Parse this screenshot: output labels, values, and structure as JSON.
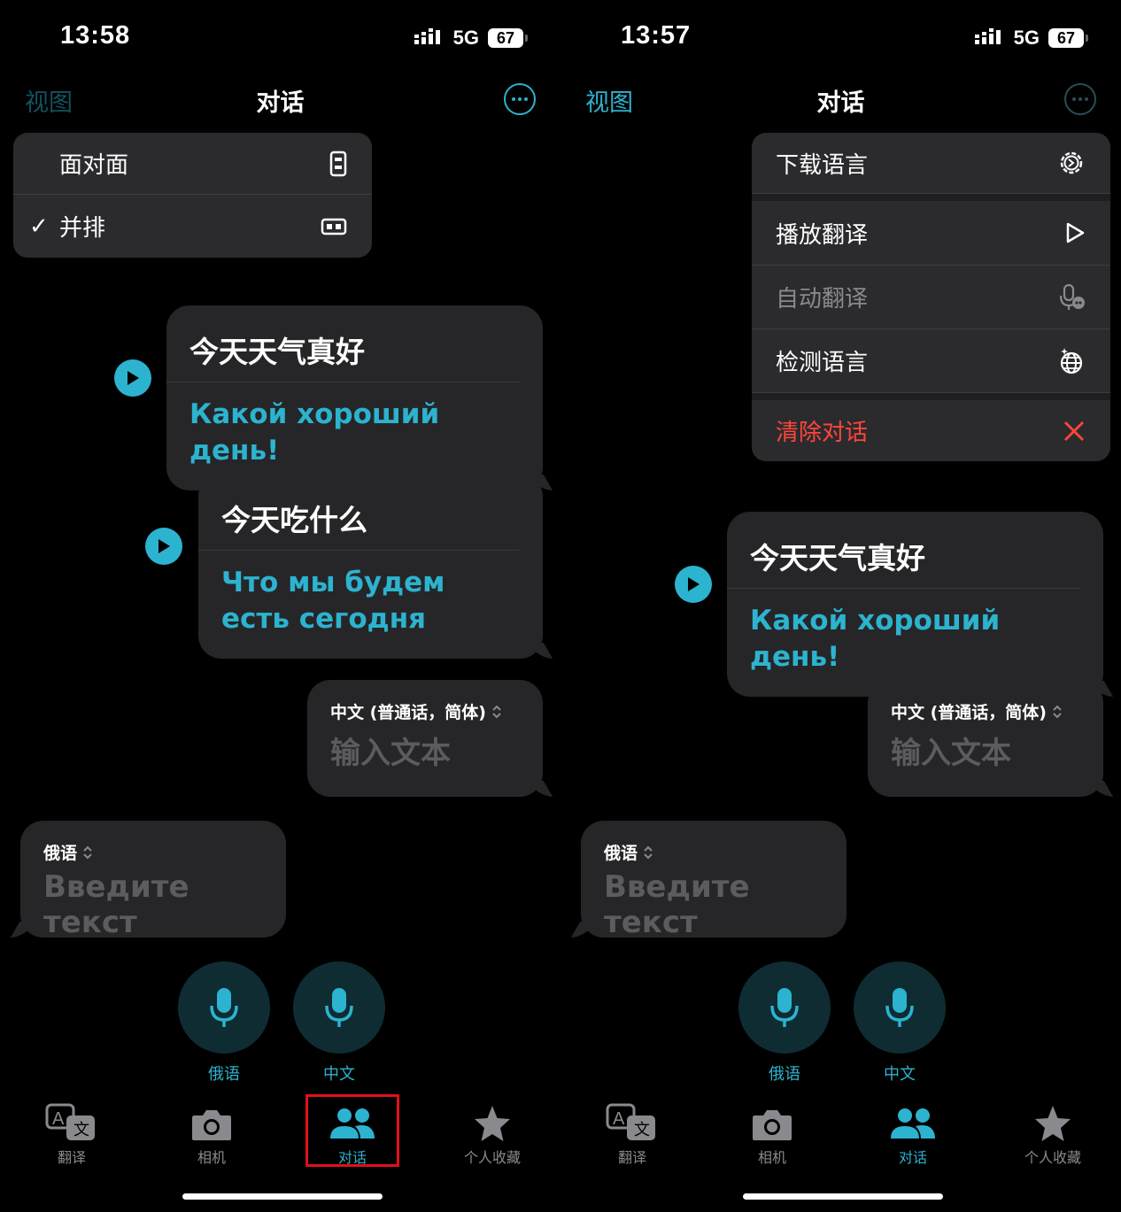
{
  "colors": {
    "accent": "#2cb3cf",
    "destructive": "#ff453a",
    "highlight": "#e0101b"
  },
  "left": {
    "time": "13:58",
    "network": "5G",
    "battery": "67",
    "nav": {
      "left": "视图",
      "title": "对话"
    },
    "view_menu": [
      {
        "label": "面对面",
        "icon": "phone-portrait-icon",
        "checked": false
      },
      {
        "check": "✓",
        "label": "并排",
        "icon": "phone-landscape-icon",
        "checked": true
      }
    ],
    "messages": [
      {
        "src": "今天天气真好",
        "dst": "Какой хороший день!"
      },
      {
        "src": "今天吃什么",
        "dst": "Что мы будем есть сегодня"
      }
    ],
    "input_zh": {
      "lang": "中文 (普通话，简体)",
      "placeholder": "输入文本"
    },
    "input_ru": {
      "lang": "俄语",
      "placeholder": "Введите текст"
    },
    "mics": [
      "俄语",
      "中文"
    ],
    "tabs": [
      "翻译",
      "相机",
      "对话",
      "个人收藏"
    ],
    "active_tab": "对话"
  },
  "right": {
    "time": "13:57",
    "network": "5G",
    "battery": "67",
    "nav": {
      "left": "视图",
      "title": "对话"
    },
    "options_menu": {
      "download": "下载语言",
      "play": "播放翻译",
      "auto": "自动翻译",
      "detect": "检测语言",
      "clear": "清除对话"
    },
    "message": {
      "src": "今天天气真好",
      "dst": "Какой хороший день!"
    },
    "input_zh": {
      "lang": "中文 (普通话，简体)",
      "placeholder": "输入文本"
    },
    "input_ru": {
      "lang": "俄语",
      "placeholder": "Введите текст"
    },
    "mics": [
      "俄语",
      "中文"
    ],
    "tabs": [
      "翻译",
      "相机",
      "对话",
      "个人收藏"
    ],
    "active_tab": "对话"
  }
}
